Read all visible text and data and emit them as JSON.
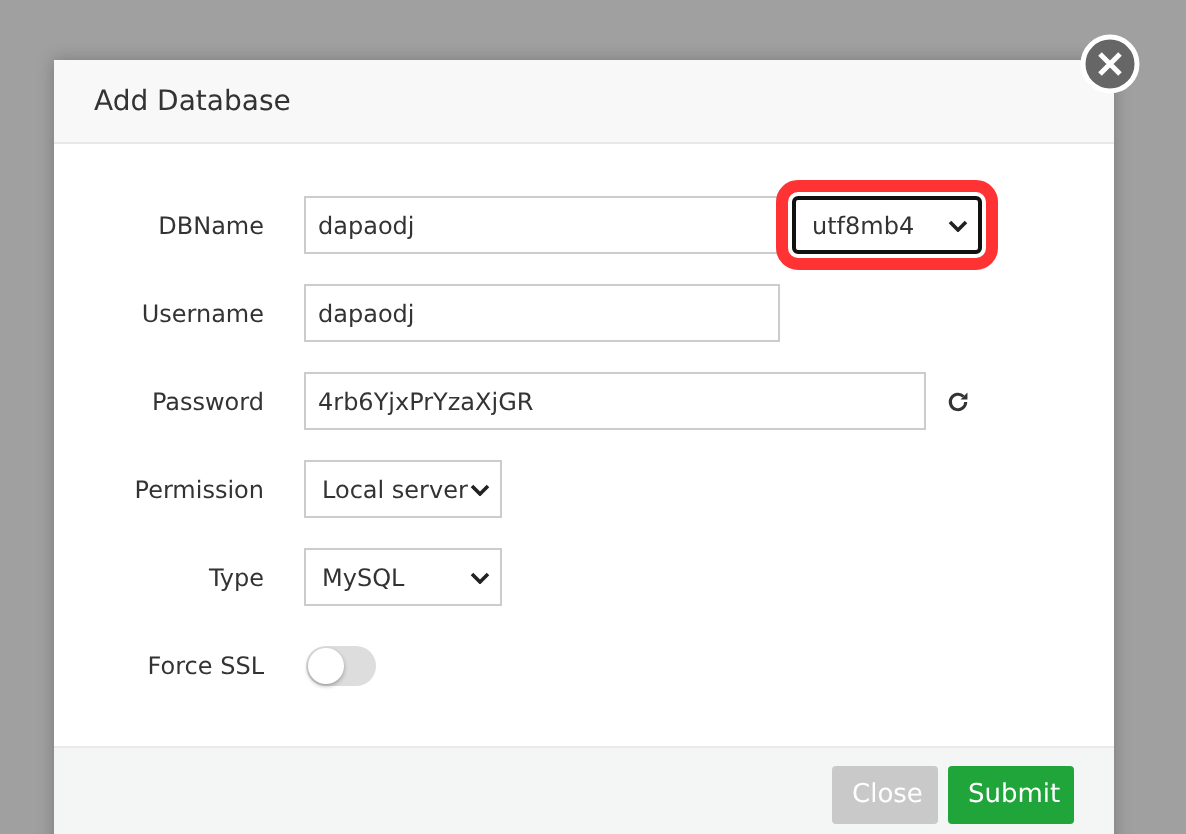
{
  "dialog": {
    "title": "Add Database"
  },
  "fields": [
    {
      "kind": "text-with-select",
      "label": "DBName",
      "value": "dapaodj",
      "select": {
        "value": "utf8mb4",
        "highlighted": true
      }
    },
    {
      "kind": "text",
      "label": "Username",
      "value": "dapaodj"
    },
    {
      "kind": "text-with-refresh",
      "label": "Password",
      "value": "4rb6YjxPrYzaXjGR"
    },
    {
      "kind": "select",
      "label": "Permission",
      "value": "Local server"
    },
    {
      "kind": "select",
      "label": "Type",
      "value": "MySQL"
    },
    {
      "kind": "toggle",
      "label": "Force SSL",
      "on": false
    }
  ],
  "buttons": [
    {
      "label": "Close",
      "kind": "secondary"
    },
    {
      "label": "Submit",
      "kind": "primary"
    }
  ]
}
